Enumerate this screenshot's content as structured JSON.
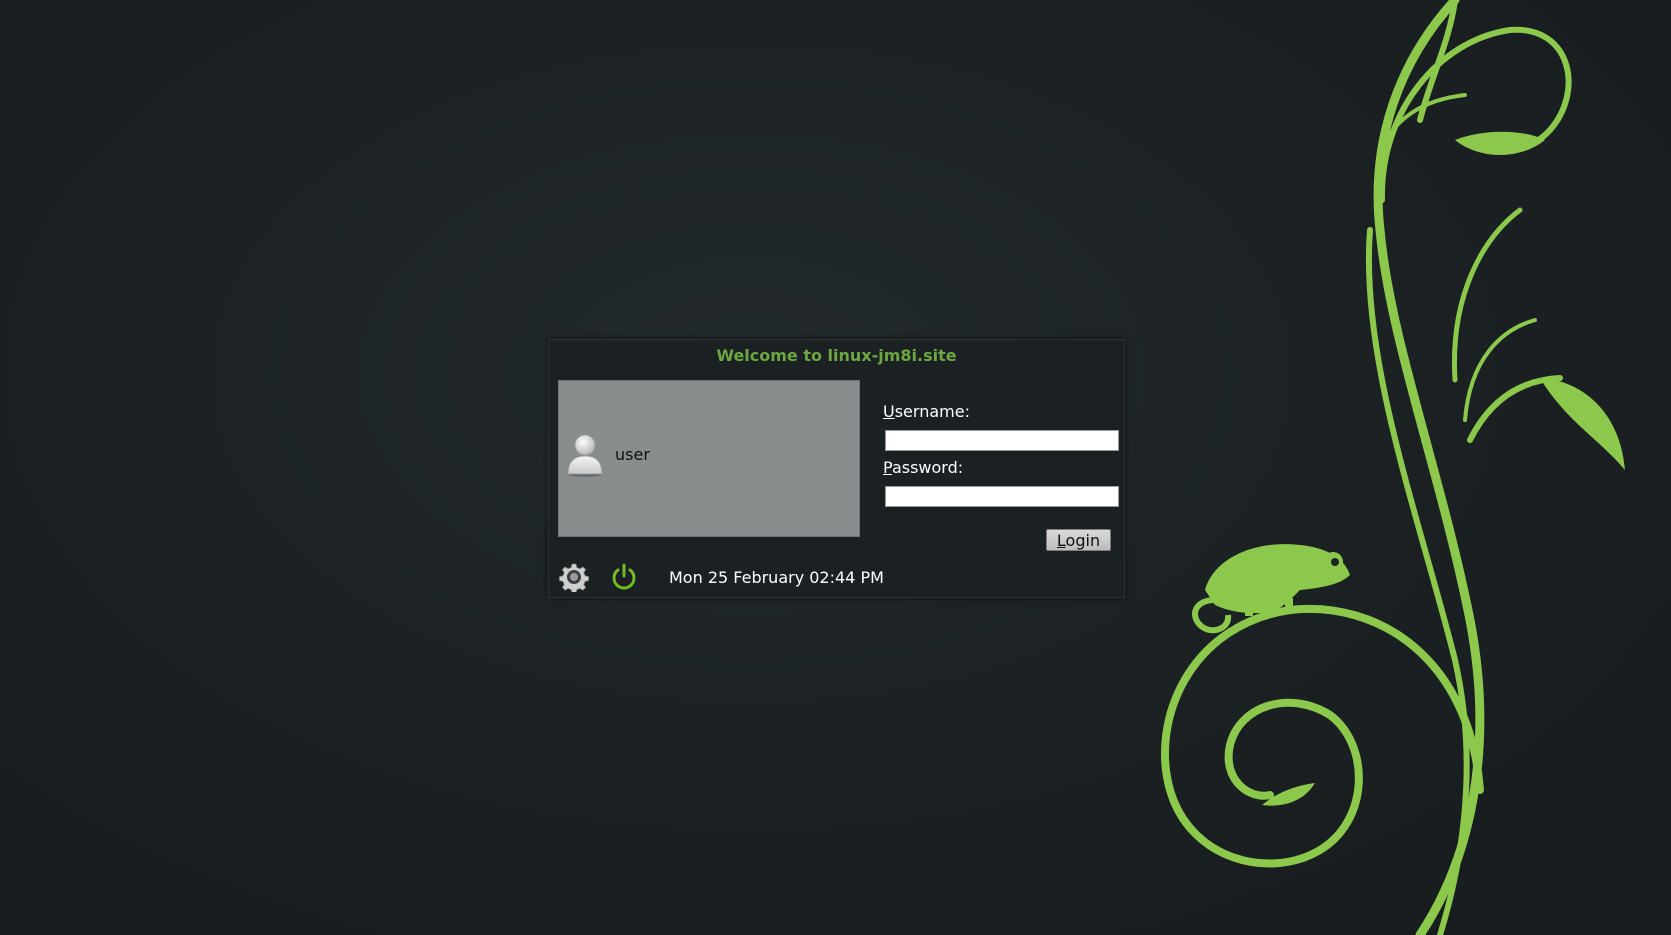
{
  "dialog": {
    "title": "Welcome to linux-jm8i.site"
  },
  "users": [
    {
      "name": "user",
      "icon": "user-avatar-icon"
    }
  ],
  "form": {
    "username_mnemonic": "U",
    "username_rest": "sername:",
    "username_value": "",
    "password_mnemonic": "P",
    "password_rest": "assword:",
    "password_value": "",
    "login_mnemonic": "L",
    "login_rest": "ogin"
  },
  "bottom_bar": {
    "settings_icon": "gear-icon",
    "power_icon": "power-icon",
    "clock": "Mon 25 February 02:44 PM"
  },
  "colors": {
    "accent_green": "#73ba25",
    "title_green": "#6da741",
    "background": "#1c2224",
    "user_list_bg": "#8a8d8e"
  }
}
